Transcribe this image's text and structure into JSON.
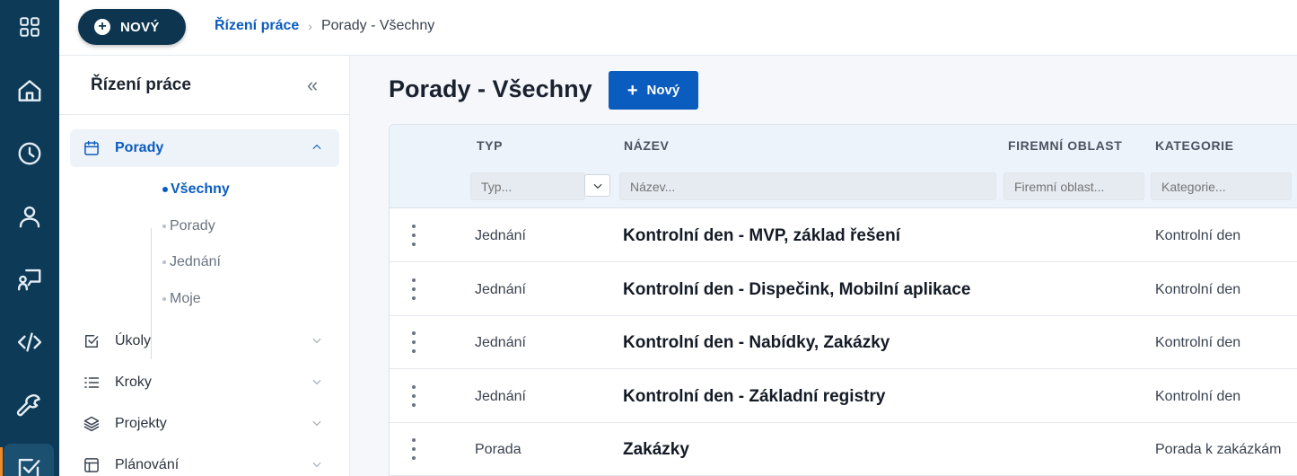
{
  "topbar": {
    "new_label": "NOVÝ",
    "breadcrumb": {
      "root": "Řízení práce",
      "current": "Porady - Všechny"
    }
  },
  "rail": {
    "icons": [
      "apps-grid-icon",
      "home-icon",
      "clock-icon",
      "user-icon",
      "presentation-icon",
      "code-icon",
      "wrench-icon",
      "checkbox-icon"
    ],
    "active": "checkbox-icon",
    "active_color": "#f08a24"
  },
  "sidepanel": {
    "title": "Řízení práce",
    "groups": [
      {
        "label": "Porady",
        "icon": "calendar-icon",
        "open": true
      },
      {
        "label": "Úkoly",
        "icon": "checkbox-icon"
      },
      {
        "label": "Kroky",
        "icon": "list-icon"
      },
      {
        "label": "Projekty",
        "icon": "layers-icon"
      },
      {
        "label": "Plánování",
        "icon": "board-icon"
      }
    ],
    "sub_items": [
      {
        "label": "Všechny",
        "active": true
      },
      {
        "label": "Porady"
      },
      {
        "label": "Jednání"
      },
      {
        "label": "Moje"
      }
    ]
  },
  "main": {
    "title": "Porady - Všechny",
    "new_label": "Nový",
    "columns": [
      "TYP",
      "NÁZEV",
      "FIREMNÍ OBLAST",
      "KATEGORIE"
    ],
    "filters": {
      "type": "Typ...",
      "name": "Název...",
      "area": "Firemní oblast...",
      "category": "Kategorie..."
    },
    "rows": [
      {
        "type": "Jednání",
        "name": "Kontrolní den - MVP, základ řešení",
        "area": "",
        "category": "Kontrolní den"
      },
      {
        "type": "Jednání",
        "name": "Kontrolní den - Dispečink, Mobilní aplikace",
        "area": "",
        "category": "Kontrolní den"
      },
      {
        "type": "Jednání",
        "name": "Kontrolní den - Nabídky, Zakázky",
        "area": "",
        "category": "Kontrolní den"
      },
      {
        "type": "Jednání",
        "name": "Kontrolní den - Základní registry",
        "area": "",
        "category": "Kontrolní den"
      },
      {
        "type": "Porada",
        "name": "Zakázky",
        "area": "",
        "category": "Porada k zakázkám"
      }
    ]
  },
  "colors": {
    "rail": "#0d3a56",
    "accent": "#0b5cbf",
    "header_bg": "#edf3fb"
  }
}
